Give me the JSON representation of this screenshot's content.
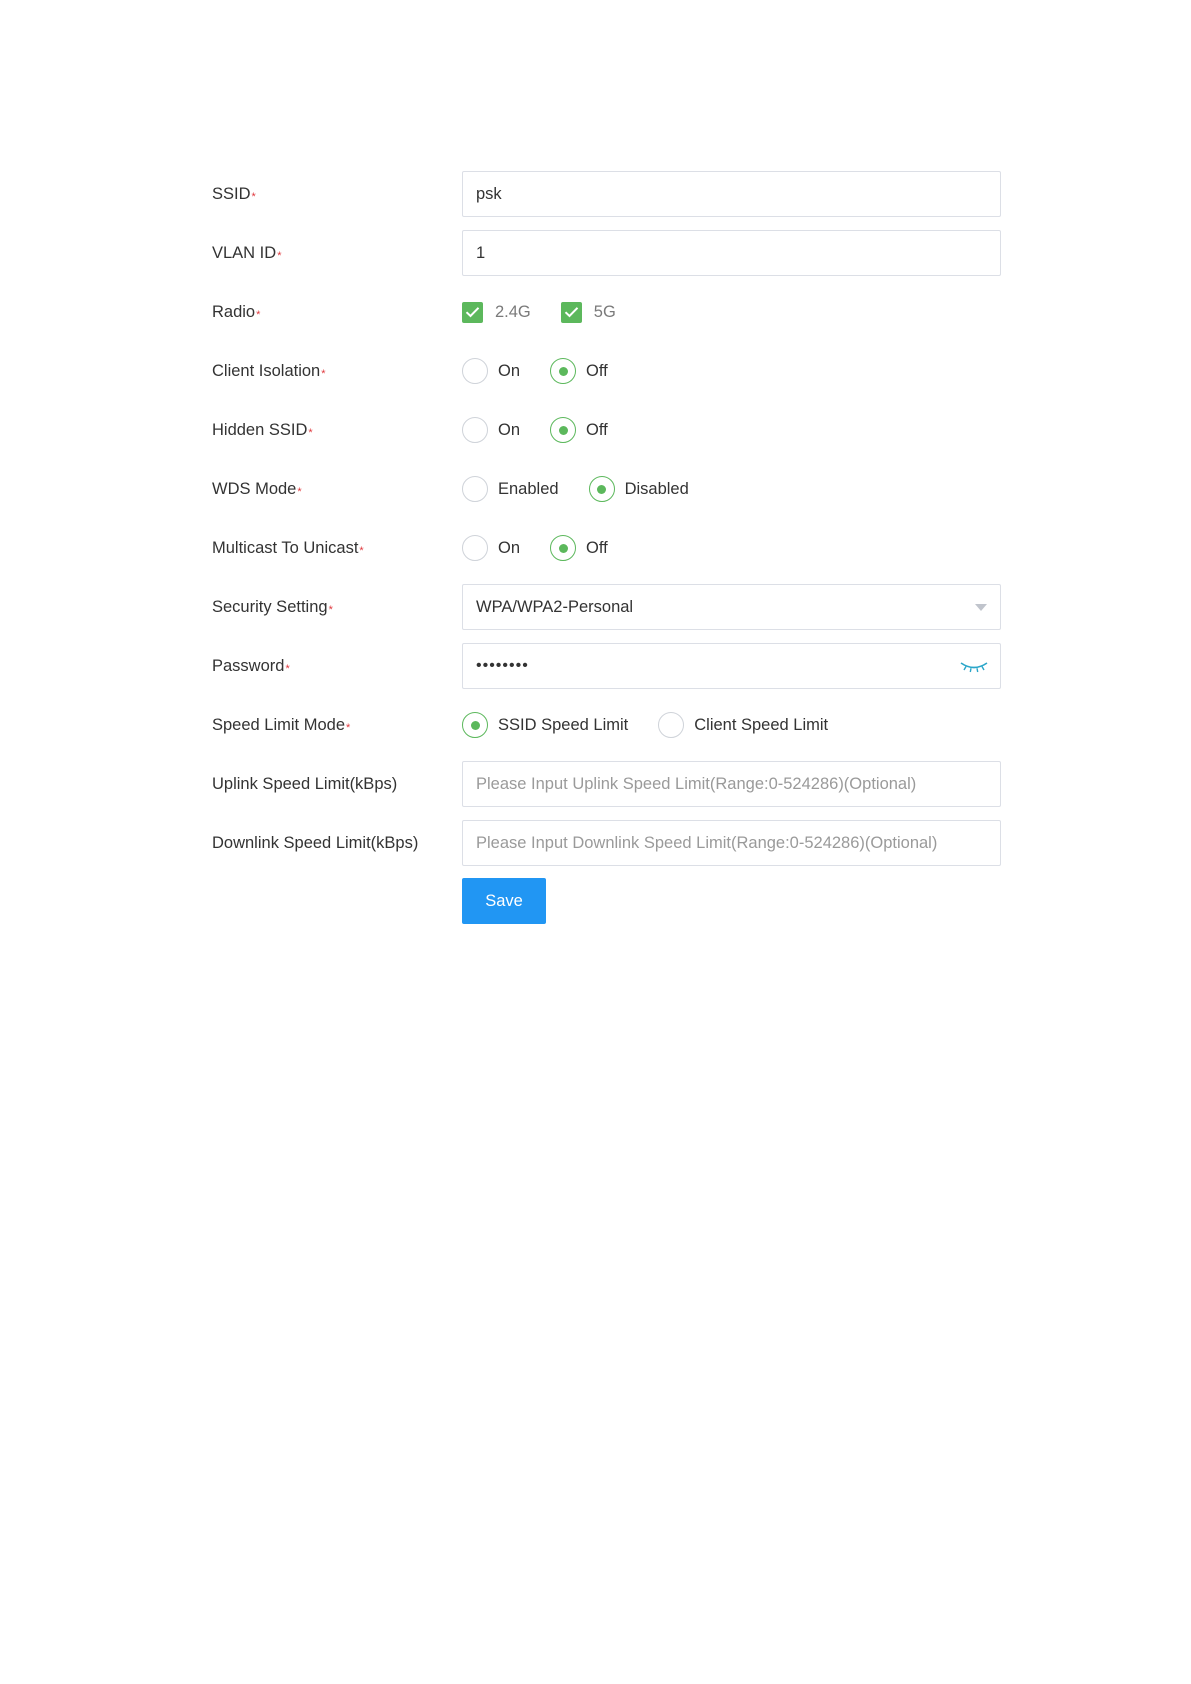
{
  "form": {
    "ssid": {
      "label": "SSID",
      "required": "*",
      "value": "psk"
    },
    "vlan_id": {
      "label": "VLAN ID",
      "required": "*",
      "value": "1"
    },
    "radio": {
      "label": "Radio",
      "required": "*",
      "options": [
        {
          "label": "2.4G",
          "checked": true
        },
        {
          "label": "5G",
          "checked": true
        }
      ]
    },
    "client_isolation": {
      "label": "Client Isolation",
      "required": "*",
      "options": [
        "On",
        "Off"
      ],
      "selected": "Off"
    },
    "hidden_ssid": {
      "label": "Hidden SSID",
      "required": "*",
      "options": [
        "On",
        "Off"
      ],
      "selected": "Off"
    },
    "wds_mode": {
      "label": "WDS Mode",
      "required": "*",
      "options": [
        "Enabled",
        "Disabled"
      ],
      "selected": "Disabled"
    },
    "multicast_to_unicast": {
      "label": "Multicast To Unicast",
      "required": "*",
      "options": [
        "On",
        "Off"
      ],
      "selected": "Off"
    },
    "security_setting": {
      "label": "Security Setting",
      "required": "*",
      "value": "WPA/WPA2-Personal"
    },
    "password": {
      "label": "Password",
      "required": "*",
      "masked_value": "••••••••",
      "icon": "eye-closed-icon"
    },
    "speed_limit_mode": {
      "label": "Speed Limit Mode",
      "required": "*",
      "options": [
        "SSID Speed Limit",
        "Client Speed Limit"
      ],
      "selected": "SSID Speed Limit"
    },
    "uplink_speed_limit": {
      "label": "Uplink Speed Limit(kBps)",
      "value": "",
      "placeholder": "Please Input Uplink Speed Limit(Range:0-524286)(Optional)"
    },
    "downlink_speed_limit": {
      "label": "Downlink Speed Limit(kBps)",
      "value": "",
      "placeholder": "Please Input Downlink Speed Limit(Range:0-524286)(Optional)"
    },
    "save_label": "Save"
  },
  "colors": {
    "accent_green": "#5cb85c",
    "primary_blue": "#2196f3",
    "required_red": "#e0393e",
    "border": "#dcdfe6"
  }
}
